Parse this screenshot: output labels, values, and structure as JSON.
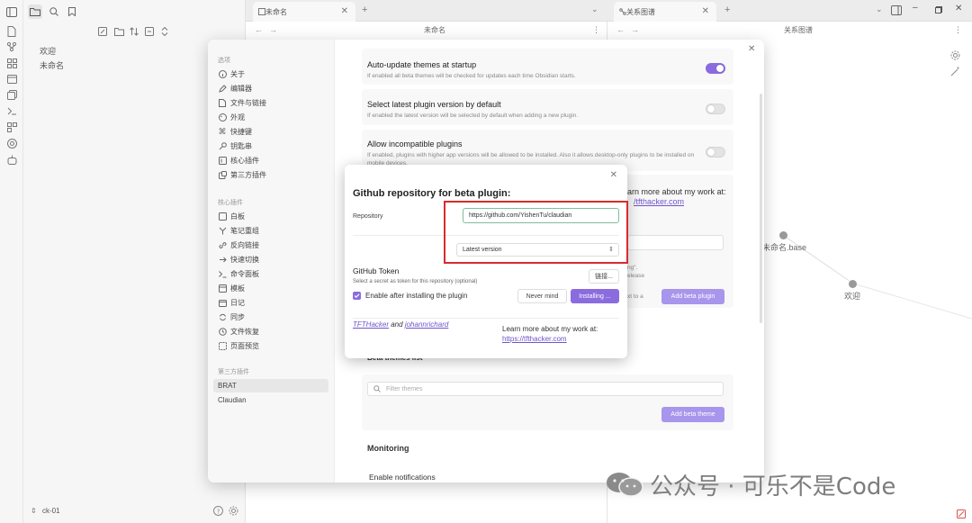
{
  "file_sidebar": {
    "items": [
      "欢迎",
      "未命名"
    ],
    "vault_name": "ck-01"
  },
  "tabs": [
    {
      "label": "未命名"
    },
    {
      "label": "关系图谱"
    }
  ],
  "panes": {
    "editor_title": "未命名",
    "graph_title": "关系图谱"
  },
  "graph": {
    "nodes": [
      "未命名.base",
      "欢迎"
    ]
  },
  "settings": {
    "groups": [
      {
        "heading": "选项",
        "items": [
          "关于",
          "编辑器",
          "文件与链接",
          "外观",
          "快捷键",
          "钥匙串",
          "核心插件",
          "第三方插件"
        ]
      },
      {
        "heading": "核心插件",
        "items": [
          "白板",
          "笔记重组",
          "反向链接",
          "快速切换",
          "命令面板",
          "模板",
          "日记",
          "同步",
          "文件恢复",
          "页面预览"
        ]
      },
      {
        "heading": "第三方插件",
        "items": [
          "BRAT",
          "Claudian"
        ]
      }
    ],
    "rows": [
      {
        "name": "Auto-update themes at startup",
        "desc": "If enabled all beta themes will be checked for updates each time Obsidian starts.",
        "toggle": true
      },
      {
        "name": "Select latest plugin version by default",
        "desc": "If enabled the latest version will be selected by default when adding a new plugin.",
        "toggle": false
      },
      {
        "name": "Allow incompatible plugins",
        "desc": "If enabled, plugins with higher app versions will be allowed to be installed. Also it allows desktop-only plugins to be installed on mobile devices.",
        "toggle": false
      }
    ],
    "partial": {
      "learn_more": "arn more about my work at:",
      "link": "/tfthacker.com",
      "snip1": "ng\".",
      "snip2": "elease",
      "snip3": "xt to a",
      "add_beta_plugin": "Add beta plugin"
    },
    "beta_themes_heading": "Beta themes list",
    "filter_placeholder": "Filter themes",
    "add_beta_theme": "Add beta theme",
    "monitoring_heading": "Monitoring",
    "enable_notifications": "Enable notifications"
  },
  "dialog": {
    "title": "Github repository for beta plugin:",
    "repo_label": "Repository",
    "repo_value": "https://github.com/YishenTu/claudian",
    "version_value": "Latest version",
    "token_label": "GitHub Token",
    "token_desc": "Select a secret as token for this repository (optional)",
    "link_button": "链接...",
    "enable_label": "Enable after installing the plugin",
    "never_mind": "Never mind",
    "installing": "Installing ...",
    "author1": "TFTHacker",
    "and": "and",
    "author2": "johannrichard",
    "learn_more": "Learn more about my work at:",
    "learn_link": "https://tfthacker.com"
  },
  "watermark": {
    "text": "公众号 · 可乐不是Code"
  }
}
